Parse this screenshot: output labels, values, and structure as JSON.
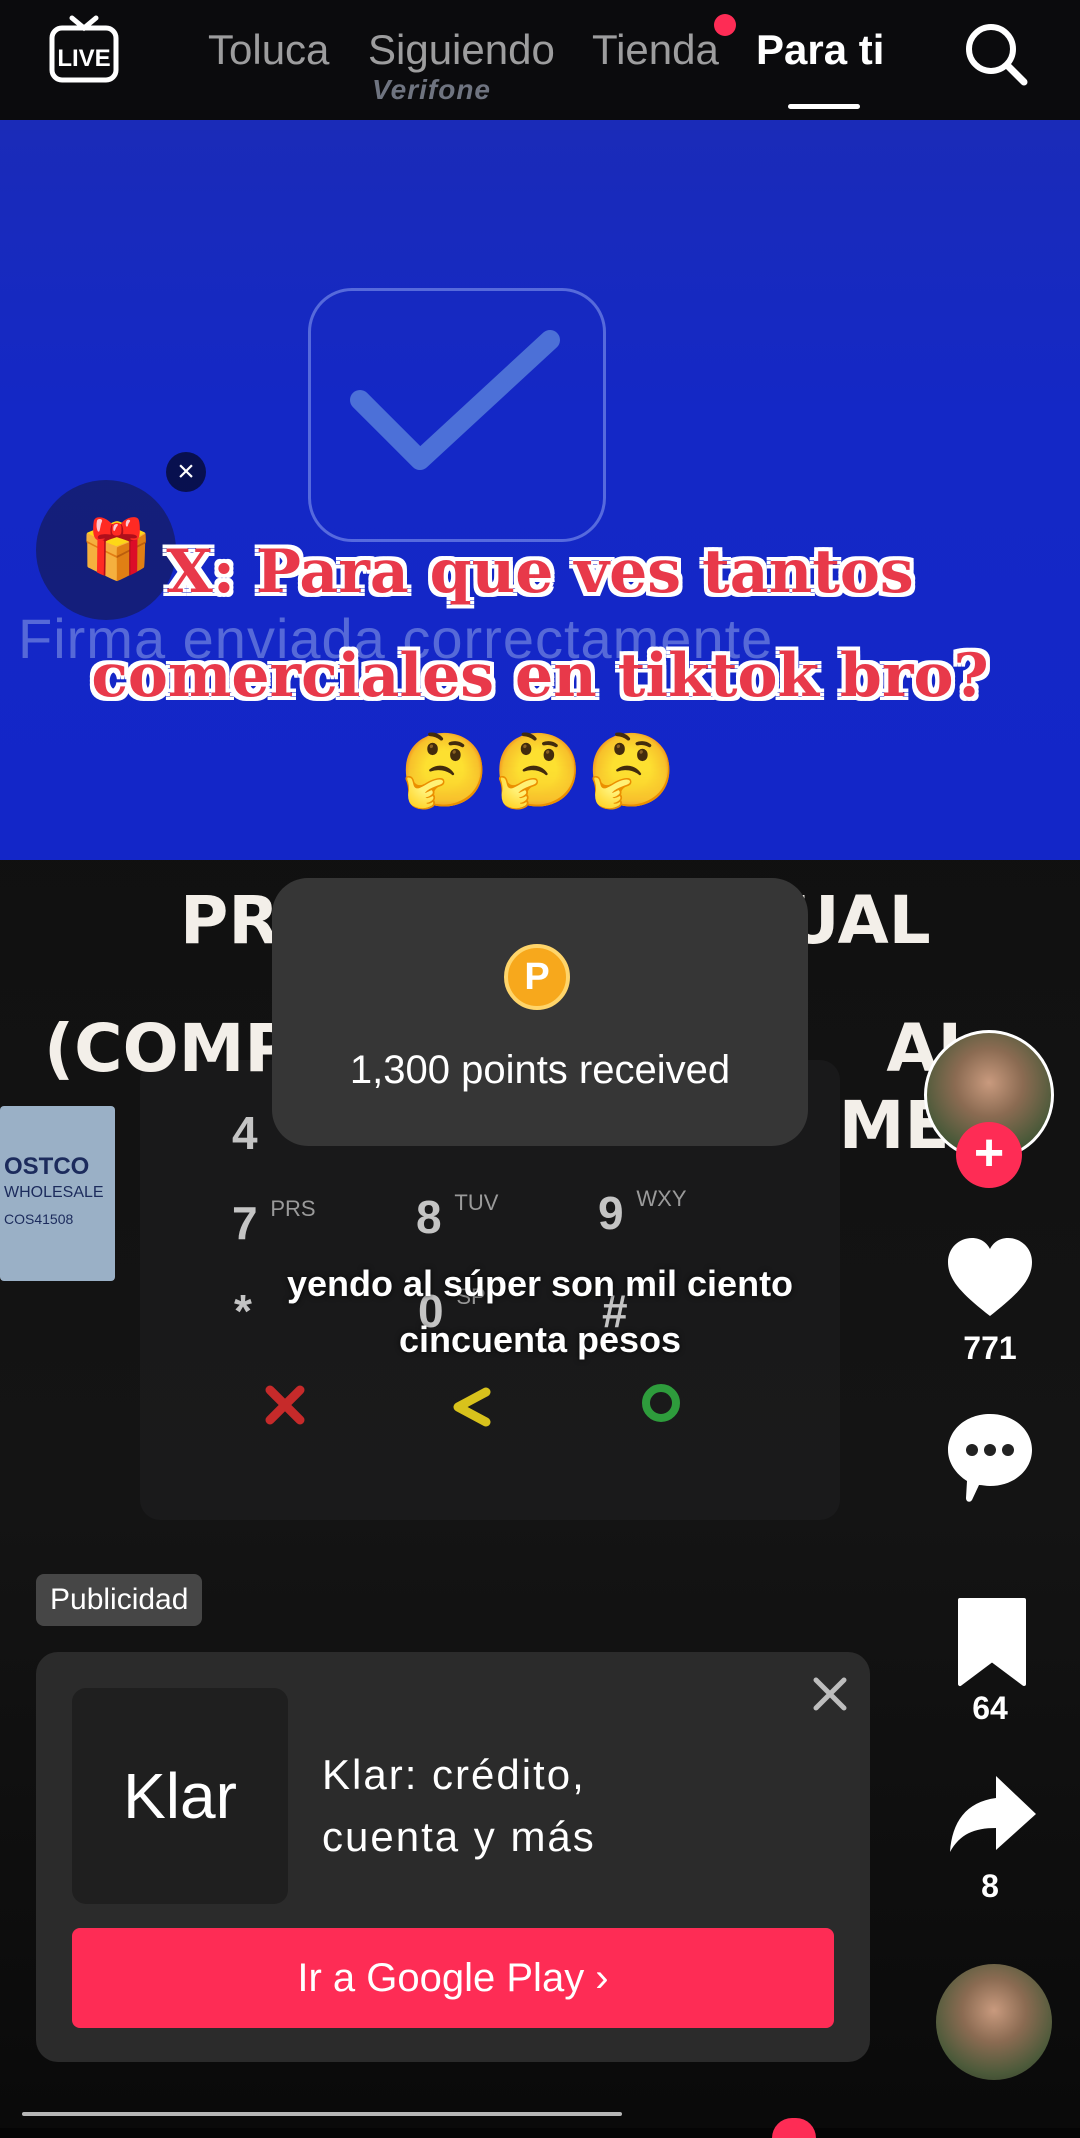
{
  "video": {
    "brand_text": "Verifone",
    "screen_message": "Firma enviada correctamente",
    "costco_label": [
      "OSTCO",
      "WHOLESALE",
      "COS41508"
    ],
    "keypad": [
      {
        "key": "4",
        "letters": ""
      },
      {
        "key": "7",
        "letters": "PRS"
      },
      {
        "key": "8",
        "letters": "TUV"
      },
      {
        "key": "9",
        "letters": "WXY"
      },
      {
        "key": "*",
        "letters": ""
      },
      {
        "key": "0",
        "letters": "SP"
      },
      {
        "key": "#",
        "letters": ""
      }
    ]
  },
  "top_nav": {
    "live_label": "LIVE",
    "tabs": [
      "Toluca",
      "Siguiendo",
      "Tienda",
      "Para ti"
    ],
    "active_tab": "Para ti"
  },
  "gift": {
    "close": "×",
    "icon": "gift-icon"
  },
  "overlay": {
    "caption_line1": "X: Para que ves tantos",
    "caption_line2": "comerciales en tiktok bro?",
    "emojis": "🤔🤔🤔",
    "headline_line1_left": "PR",
    "headline_line1_right": "UAL",
    "headline_line2_left": "(COMP",
    "headline_line2_right": "AL MES)",
    "subtitle_line1": "yendo al súper son mil ciento",
    "subtitle_line2": "cincuenta pesos"
  },
  "points_toast": {
    "coin_letter": "P",
    "text": "1,300 points received"
  },
  "rail": {
    "follow": "+",
    "likes": "771",
    "saves": "64",
    "shares": "8"
  },
  "ad": {
    "badge": "Publicidad",
    "logo_text": "Klar",
    "name_line1": "Klar: crédito,",
    "name_line2": "cuenta y más",
    "cta": "Ir a Google Play ›"
  },
  "colors": {
    "accent": "#fe2c55",
    "screen_blue": "#1428c6"
  }
}
